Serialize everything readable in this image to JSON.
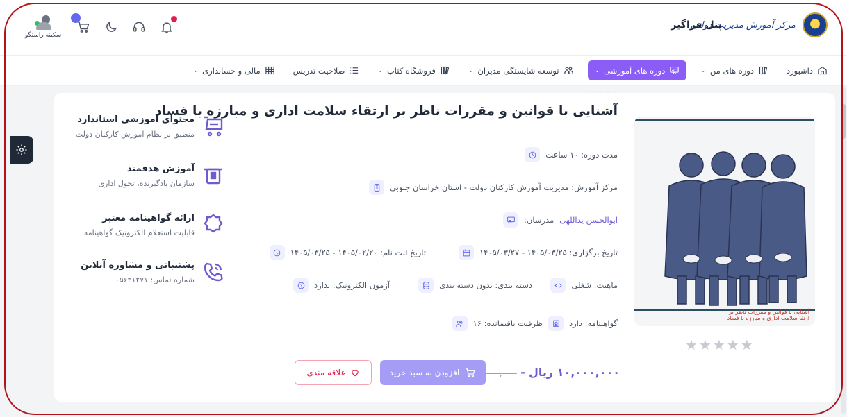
{
  "header": {
    "brand_script": "مرکز آموزش مدیریت دولتی",
    "panel_title": "پنل فراگیر",
    "user_name": "سکینه راستگو"
  },
  "nav": {
    "items": [
      {
        "label": "داشبورد",
        "icon": "home-icon",
        "chevron": false
      },
      {
        "label": "دوره های من",
        "icon": "books-icon",
        "chevron": true
      },
      {
        "label": "دوره های آموزشی",
        "icon": "presentation-icon",
        "chevron": true,
        "active": true
      },
      {
        "label": "توسعه شایستگی مدیران",
        "icon": "users-icon",
        "chevron": true
      },
      {
        "label": "فروشگاه کتاب",
        "icon": "books-icon",
        "chevron": true
      },
      {
        "label": "صلاحیت تدریس",
        "icon": "list-icon",
        "chevron": false
      },
      {
        "label": "مالی و حسابداری",
        "icon": "table-icon",
        "chevron": true
      }
    ]
  },
  "course": {
    "title": "آشنایی با قوانین و مقررات ناظر بر ارتقاء سلامت اداری و مبارزه با فساد",
    "image_caption_line1": "آشنایی با قوانین و مقررات ناظر بر",
    "image_caption_line2": "ارتقا سلامت اداری و مبارزه با فساد",
    "rating_stars": 0,
    "duration": "مدت دوره: ۱۰ ساعت",
    "center": "مرکز آموزش: مدیریت آموزش کارکنان دولت - استان خراسان جنوبی",
    "teachers_label": "مدرسان:",
    "teachers_value": "ابوالحسن یداللهی",
    "held_date": "تاریخ برگزاری: ۱۴۰۵/۰۳/۲۵ - ۱۴۰۵/۰۳/۲۷",
    "register_date": "تاریخ ثبت نام: ۱۴۰۵/۰۲/۲۰ - ۱۴۰۵/۰۳/۲۵",
    "nature": "ماهیت: شغلی",
    "category": "دسته بندی: بدون دسته بندی",
    "exam": "آزمون الکترونیک: ندارد",
    "certificate": "گواهینامه: دارد",
    "capacity": "ظرفیت باقیمانده: ۱۶"
  },
  "pricing": {
    "price": "۱۰,۰۰۰,۰۰۰ ریال",
    "old_price": "۲۰,۰۰۰,۰۰۰",
    "add_to_cart": "افزودن به سبد خرید",
    "wishlist": "علاقه مندی"
  },
  "features": [
    {
      "title": "محتوای آموزشی استاندارد",
      "subtitle": "منطبق بر نظام آموزش کارکنان دولت",
      "icon": "cart-icon"
    },
    {
      "title": "آموزش هدفمند",
      "subtitle": "سازمان یادگیرنده، تحول اداری",
      "icon": "target-icon"
    },
    {
      "title": "ارائه گواهینامه معتبر",
      "subtitle": "قابلیت استعلام الکترونیک گواهینامه",
      "icon": "badge-icon"
    },
    {
      "title": "پشتیبانی و مشاوره آنلاین",
      "subtitle": "شماره تماس: ۰۵۶۳۱۲۷۱",
      "icon": "phone-icon"
    }
  ],
  "colors": {
    "accent": "#8b5cf6",
    "accent_light": "#a59cf5",
    "wishlist": "#e11d48",
    "annotation_frame": "#b3121b"
  }
}
